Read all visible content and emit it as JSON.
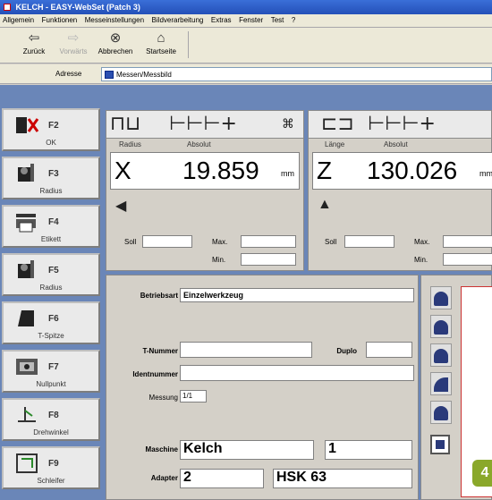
{
  "window": {
    "title": "KELCH - EASY-WebSet (Patch 3)"
  },
  "menu": [
    "Allgemein",
    "Funktionen",
    "Messeinstellungen",
    "Bildverarbeitung",
    "Extras",
    "Fenster",
    "Test",
    "?"
  ],
  "toolbar": {
    "back": "Zurück",
    "forward": "Vorwärts",
    "cancel": "Abbrechen",
    "home": "Startseite"
  },
  "address": {
    "label": "Adresse",
    "value": "Messen/Messbild"
  },
  "fkeys": [
    {
      "key": "F2",
      "label": "OK",
      "icon": "ok-icon"
    },
    {
      "key": "F3",
      "label": "Radius",
      "icon": "radius-tool-icon"
    },
    {
      "key": "F4",
      "label": "Etikett",
      "icon": "printer-icon"
    },
    {
      "key": "F5",
      "label": "Radius",
      "icon": "radius-tool-icon"
    },
    {
      "key": "F6",
      "label": "T-Spitze",
      "icon": "tool-tip-icon"
    },
    {
      "key": "F7",
      "label": "Nullpunkt",
      "icon": "zero-point-icon"
    },
    {
      "key": "F8",
      "label": "Drehwinkel",
      "icon": "rotation-angle-icon"
    },
    {
      "key": "F9",
      "label": "Schleifer",
      "icon": "grinder-icon"
    }
  ],
  "axes": {
    "x": {
      "letter": "X",
      "sub1": "Radius",
      "sub2": "Absolut",
      "value": "19.859",
      "unit": "mm",
      "soll": "Soll",
      "max": "Max.",
      "min": "Min."
    },
    "z": {
      "letter": "Z",
      "sub1": "Länge",
      "sub2": "Absolut",
      "value": "130.026",
      "unit": "mm",
      "soll": "Soll",
      "max": "Max.",
      "min": "Min."
    }
  },
  "form": {
    "betriebsart_label": "Betriebsart",
    "betriebsart_value": "Einzelwerkzeug",
    "tnummer_label": "T-Nummer",
    "duplo_label": "Duplo",
    "ident_label": "Identnummer",
    "messung_label": "Messung",
    "messung_value": "1/1",
    "maschine_label": "Maschine",
    "maschine_value": "Kelch",
    "maschine_num": "1",
    "adapter_label": "Adapter",
    "adapter_value": "2",
    "adapter_type": "HSK 63"
  },
  "badge": "4"
}
